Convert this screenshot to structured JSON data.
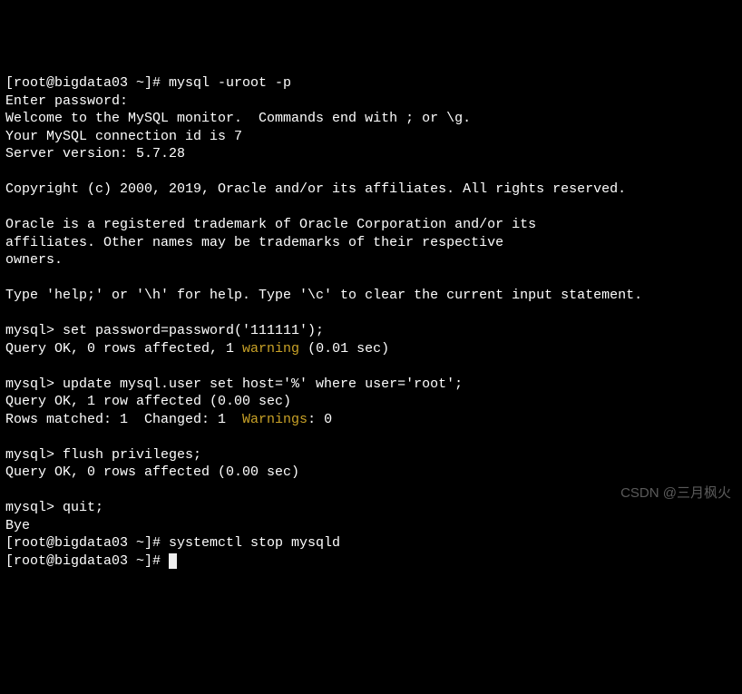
{
  "prompt1": "[root@bigdata03 ~]# mysql -uroot -p",
  "enter_pw": "Enter password:",
  "welcome": "Welcome to the MySQL monitor.  Commands end with ; or \\g.",
  "conn_id": "Your MySQL connection id is 7",
  "server_ver": "Server version: 5.7.28",
  "copyright": "Copyright (c) 2000, 2019, Oracle and/or its affiliates. All rights reserved.",
  "trademark1": "Oracle is a registered trademark of Oracle Corporation and/or its",
  "trademark2": "affiliates. Other names may be trademarks of their respective",
  "trademark3": "owners.",
  "help_line": "Type 'help;' or '\\h' for help. Type '\\c' to clear the current input statement.",
  "cmd1": "mysql> set password=password('111111');",
  "res1a": "Query OK, 0 rows affected, 1 ",
  "res1_warn": "warning",
  "res1b": " (0.01 sec)",
  "cmd2": "mysql> update mysql.user set host='%' where user='root';",
  "res2": "Query OK, 1 row affected (0.00 sec)",
  "res2b_a": "Rows matched: 1  Changed: 1  ",
  "res2b_warn": "Warnings",
  "res2b_b": ": 0",
  "cmd3": "mysql> flush privileges;",
  "res3": "Query OK, 0 rows affected (0.00 sec)",
  "cmd4": "mysql> quit;",
  "bye": "Bye",
  "prompt2": "[root@bigdata03 ~]# systemctl stop mysqld",
  "prompt3": "[root@bigdata03 ~]# ",
  "watermark": "CSDN @三月枫火"
}
